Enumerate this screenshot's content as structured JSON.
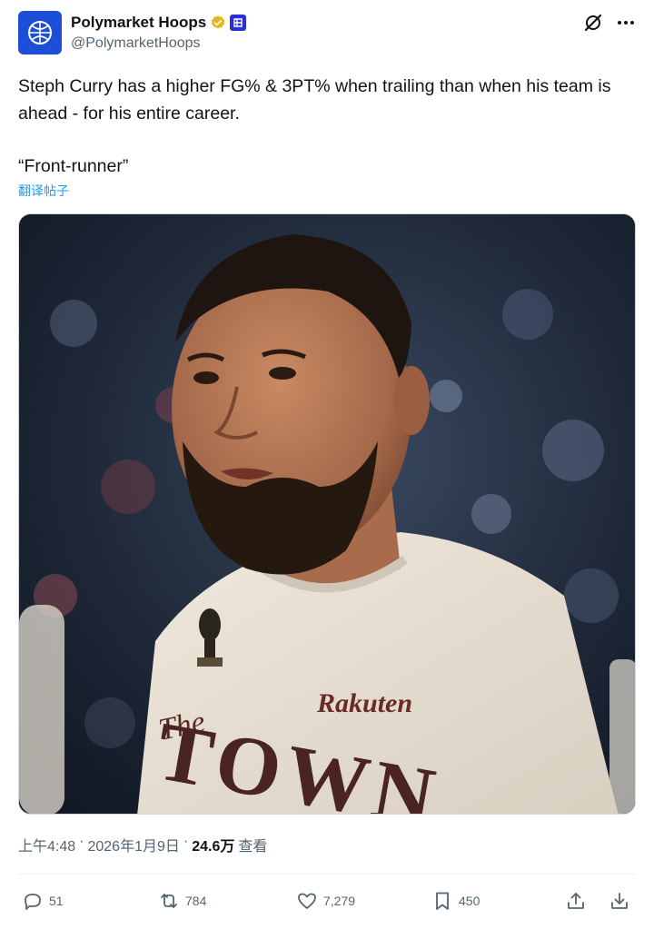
{
  "author": {
    "display_name": "Polymarket Hoops",
    "handle": "@PolymarketHoops",
    "avatar_icon": "basketball-globe-icon",
    "verified_icon": "gold-verified-badge-icon",
    "affiliation_icon": "polymarket-affiliate-icon"
  },
  "tweet": {
    "line1": "Steph Curry has a higher FG% & 3PT% when trailing than when his team is ahead - for his entire career.",
    "line2": "“Front-runner”",
    "translate_label": "翻译帖子"
  },
  "media": {
    "jersey_text_top": "The",
    "jersey_text_main": "TOWN",
    "sponsor": "Rakuten"
  },
  "meta": {
    "time": "上午4:48",
    "sep1": "·",
    "date": "2026年1月9日",
    "sep2": "·",
    "views_count": "24.6万",
    "views_label": "查看"
  },
  "actions": {
    "replies": "51",
    "reposts": "784",
    "likes": "7,279",
    "bookmarks": "450"
  },
  "colors": {
    "accent": "#1d9bf0",
    "secondary_text": "#536471",
    "verified_gold": "#e2b719",
    "avatar_bg": "#1d4ed8"
  }
}
